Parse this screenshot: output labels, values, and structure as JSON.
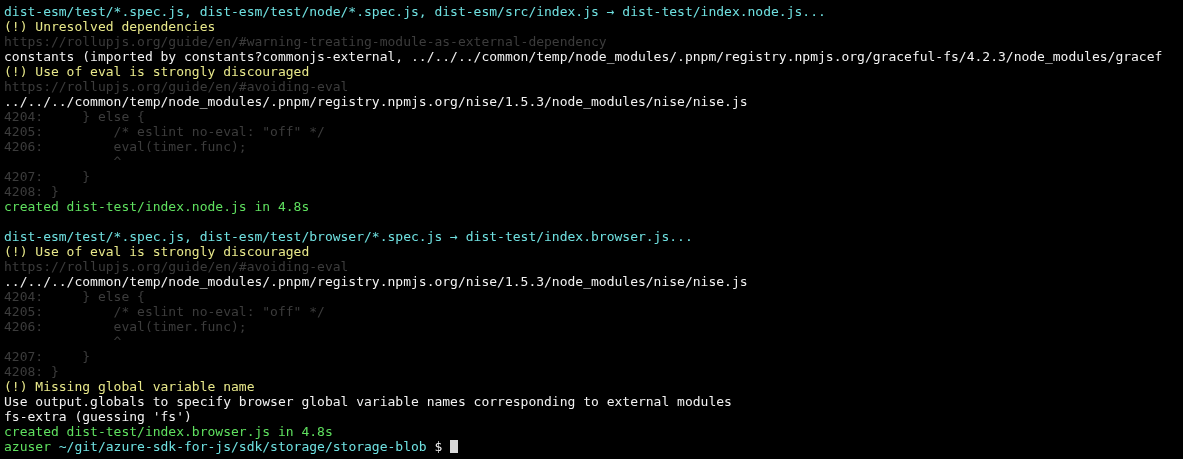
{
  "terminal": {
    "lines": [
      {
        "kind": "command",
        "text": "dist-esm/test/*.spec.js, dist-esm/test/node/*.spec.js, dist-esm/src/index.js → dist-test/index.node.js..."
      },
      {
        "kind": "warning",
        "text": "(!) Unresolved dependencies"
      },
      {
        "kind": "link",
        "text": "https://rollupjs.org/guide/en/#warning-treating-module-as-external-dependency"
      },
      {
        "kind": "text",
        "text": "constants (imported by constants?commonjs-external, ../../../common/temp/node_modules/.pnpm/registry.npmjs.org/graceful-fs/4.2.3/node_modules/gracef"
      },
      {
        "kind": "warning",
        "text": "(!) Use of eval is strongly discouraged"
      },
      {
        "kind": "link",
        "text": "https://rollupjs.org/guide/en/#avoiding-eval"
      },
      {
        "kind": "text",
        "text": "../../../common/temp/node_modules/.pnpm/registry.npmjs.org/nise/1.5.3/node_modules/nise/nise.js"
      },
      {
        "kind": "code",
        "text": "4204:     } else {"
      },
      {
        "kind": "code",
        "text": "4205:         /* eslint no-eval: \"off\" */"
      },
      {
        "kind": "code",
        "text": "4206:         eval(timer.func);"
      },
      {
        "kind": "code",
        "text": "              ^"
      },
      {
        "kind": "code",
        "text": "4207:     }"
      },
      {
        "kind": "code",
        "text": "4208: }"
      },
      {
        "kind": "success",
        "text": "created dist-test/index.node.js in 4.8s"
      },
      {
        "kind": "blank"
      },
      {
        "kind": "command",
        "text": "dist-esm/test/*.spec.js, dist-esm/test/browser/*.spec.js → dist-test/index.browser.js..."
      },
      {
        "kind": "warning",
        "text": "(!) Use of eval is strongly discouraged"
      },
      {
        "kind": "link",
        "text": "https://rollupjs.org/guide/en/#avoiding-eval"
      },
      {
        "kind": "text",
        "text": "../../../common/temp/node_modules/.pnpm/registry.npmjs.org/nise/1.5.3/node_modules/nise/nise.js"
      },
      {
        "kind": "code",
        "text": "4204:     } else {"
      },
      {
        "kind": "code",
        "text": "4205:         /* eslint no-eval: \"off\" */"
      },
      {
        "kind": "code",
        "text": "4206:         eval(timer.func);"
      },
      {
        "kind": "code",
        "text": "              ^"
      },
      {
        "kind": "code",
        "text": "4207:     }"
      },
      {
        "kind": "code",
        "text": "4208: }"
      },
      {
        "kind": "warning",
        "text": "(!) Missing global variable name"
      },
      {
        "kind": "text",
        "text": "Use output.globals to specify browser global variable names corresponding to external modules"
      },
      {
        "kind": "text",
        "text": "fs-extra (guessing 'fs')"
      },
      {
        "kind": "success",
        "text": "created dist-test/index.browser.js in 4.8s"
      }
    ],
    "prompt": {
      "user": "azuser",
      "path": "~/git/azure-sdk-for-js/sdk/storage/storage-blob",
      "symbol": "$"
    }
  }
}
